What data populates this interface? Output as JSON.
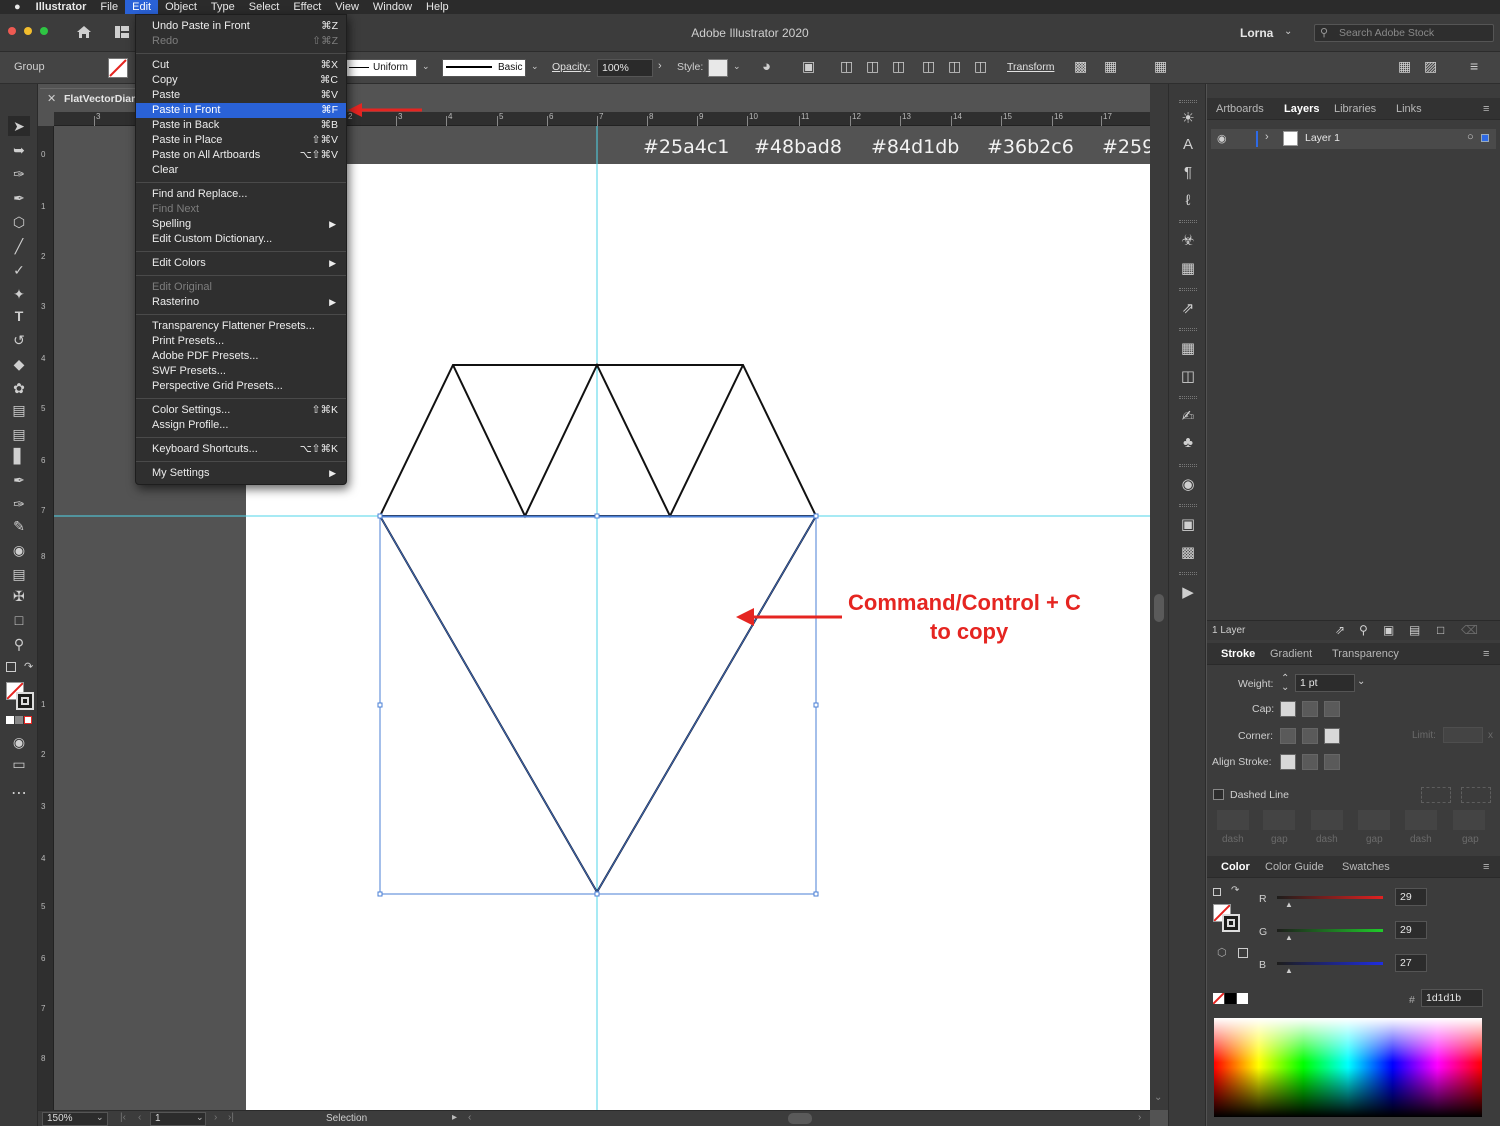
{
  "menubar": {
    "apple": "",
    "app": "Illustrator",
    "items": [
      "File",
      "Edit",
      "Object",
      "Type",
      "Select",
      "Effect",
      "View",
      "Window",
      "Help"
    ]
  },
  "titlebar": {
    "title": "Adobe Illustrator 2020",
    "user": "Lorna",
    "search_placeholder": "Search Adobe Stock"
  },
  "controlbar": {
    "selection_type": "Group",
    "stroke_profile": "Uniform",
    "brush": "Basic",
    "opacity_label": "Opacity:",
    "opacity_value": "100%",
    "style_label": "Style:",
    "transform_label": "Transform"
  },
  "document": {
    "tab_name": "FlatVectorDiam"
  },
  "ruler": {
    "h_ticks": [
      "3",
      "2",
      "3",
      "4",
      "5",
      "6",
      "7",
      "8",
      "9",
      "10",
      "11",
      "12",
      "13",
      "14",
      "15",
      "16",
      "17"
    ],
    "v_ticks": [
      "0",
      "1",
      "2",
      "3",
      "4",
      "5",
      "6",
      "7",
      "8",
      "1",
      "2",
      "3",
      "4",
      "5",
      "6",
      "7",
      "8"
    ]
  },
  "artboard": {
    "swatches": [
      "#25a4c1",
      "#48bad8",
      "#84d1db",
      "#36b2c6",
      "#259"
    ],
    "annotation_line1": "Command/Control + C",
    "annotation_line2": "to copy"
  },
  "edit_menu": {
    "groups": [
      [
        {
          "label": "Undo Paste in Front",
          "shortcut": "⌘Z",
          "disabled": false
        },
        {
          "label": "Redo",
          "shortcut": "⇧⌘Z",
          "disabled": true
        }
      ],
      [
        {
          "label": "Cut",
          "shortcut": "⌘X"
        },
        {
          "label": "Copy",
          "shortcut": "⌘C"
        },
        {
          "label": "Paste",
          "shortcut": "⌘V"
        },
        {
          "label": "Paste in Front",
          "shortcut": "⌘F",
          "highlighted": true
        },
        {
          "label": "Paste in Back",
          "shortcut": "⌘B"
        },
        {
          "label": "Paste in Place",
          "shortcut": "⇧⌘V"
        },
        {
          "label": "Paste on All Artboards",
          "shortcut": "⌥⇧⌘V"
        },
        {
          "label": "Clear",
          "shortcut": ""
        }
      ],
      [
        {
          "label": "Find and Replace...",
          "shortcut": ""
        },
        {
          "label": "Find Next",
          "shortcut": "",
          "disabled": true
        },
        {
          "label": "Spelling",
          "submenu": true
        },
        {
          "label": "Edit Custom Dictionary...",
          "shortcut": ""
        }
      ],
      [
        {
          "label": "Edit Colors",
          "submenu": true
        }
      ],
      [
        {
          "label": "Edit Original",
          "shortcut": "",
          "disabled": true
        },
        {
          "label": "Rasterino",
          "submenu": true
        }
      ],
      [
        {
          "label": "Transparency Flattener Presets...",
          "shortcut": ""
        },
        {
          "label": "Print Presets...",
          "shortcut": ""
        },
        {
          "label": "Adobe PDF Presets...",
          "shortcut": ""
        },
        {
          "label": "SWF Presets...",
          "shortcut": ""
        },
        {
          "label": "Perspective Grid Presets...",
          "shortcut": ""
        }
      ],
      [
        {
          "label": "Color Settings...",
          "shortcut": "⇧⌘K"
        },
        {
          "label": "Assign Profile...",
          "shortcut": ""
        }
      ],
      [
        {
          "label": "Keyboard Shortcuts...",
          "shortcut": "⌥⇧⌘K"
        }
      ],
      [
        {
          "label": "My Settings",
          "submenu": true
        }
      ]
    ]
  },
  "layers_panel": {
    "tabs": [
      "Artboards",
      "Layers",
      "Libraries",
      "Links"
    ],
    "active_tab": "Layers",
    "layers": [
      {
        "name": "Layer 1"
      }
    ],
    "footer": "1 Layer"
  },
  "stroke_panel": {
    "tabs": [
      "Stroke",
      "Gradient",
      "Transparency"
    ],
    "weight_label": "Weight:",
    "weight_value": "1 pt",
    "cap_label": "Cap:",
    "corner_label": "Corner:",
    "limit_label": "Limit:",
    "limit_value": "x",
    "align_label": "Align Stroke:",
    "dashed_label": "Dashed Line",
    "dash_labels": [
      "dash",
      "gap",
      "dash",
      "gap",
      "dash",
      "gap"
    ]
  },
  "color_panel": {
    "tabs": [
      "Color",
      "Color Guide",
      "Swatches"
    ],
    "channels": [
      {
        "name": "R",
        "value": "29",
        "gradient": "linear-gradient(to right,#1d1d1b,#e12121)"
      },
      {
        "name": "G",
        "value": "29",
        "gradient": "linear-gradient(to right,#1d1d1b,#1fcc2a)"
      },
      {
        "name": "B",
        "value": "27",
        "gradient": "linear-gradient(to right,#1d1d1b,#1f2de1)"
      }
    ],
    "hex_label": "#",
    "hex_value": "1d1d1b"
  },
  "statusbar": {
    "zoom": "150%",
    "artboard_number": "1",
    "tool": "Selection"
  },
  "colors": {
    "accent": "#2a62d7",
    "guide": "#4fd6e8",
    "annotation": "#e52521",
    "selection": "#4a7fd6"
  }
}
